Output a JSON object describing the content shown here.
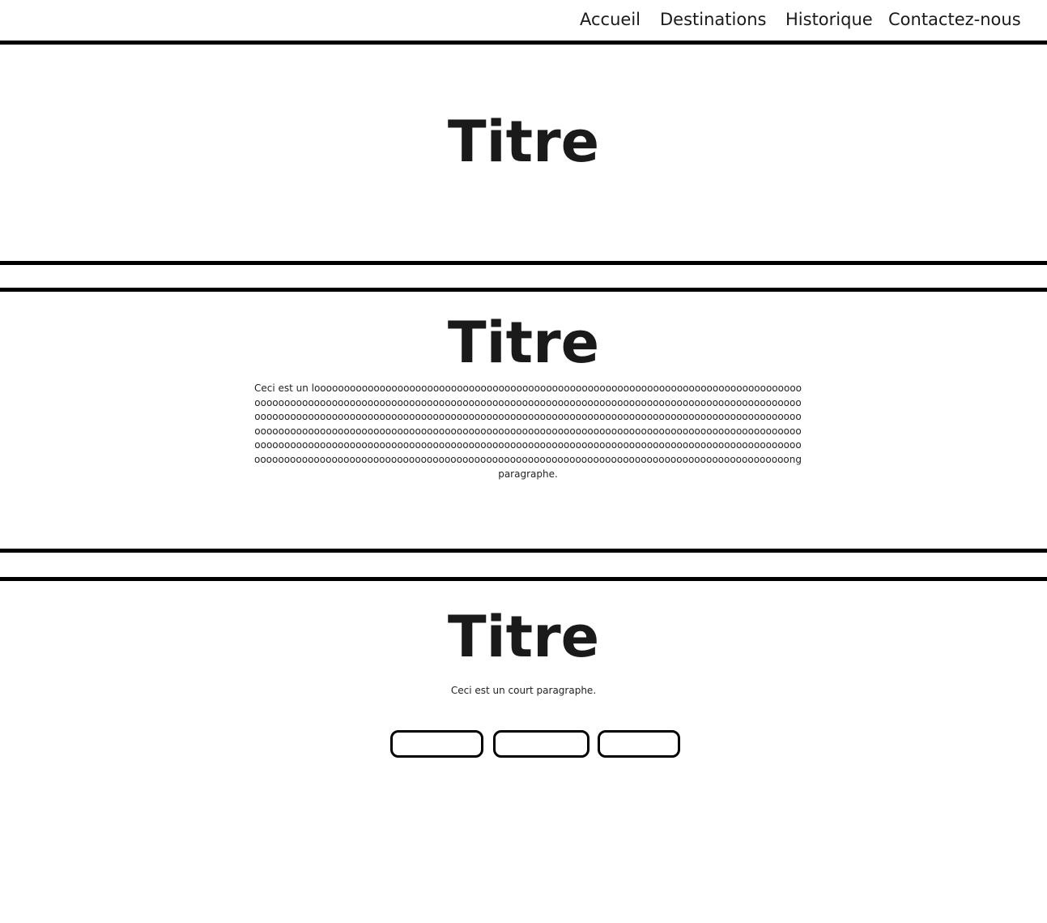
{
  "nav": {
    "items": [
      {
        "label": "Accueil"
      },
      {
        "label": "Destinations"
      },
      {
        "label": "Historique"
      },
      {
        "label": "Contactez-nous"
      }
    ]
  },
  "sections": [
    {
      "title": "Titre"
    },
    {
      "title": "Titre",
      "paragraph": "Ceci est un loooooooooooooooooooooooooooooooooooooooooooooooooooooooooooooooooooooooooooooooooooooooooooooooooooooooooooooooooooooooooooooooooooooooooooooooooooooooooooooooooooooooooooooooooooooooooooooooooooooooooooooooooooooooooooooooooooooooooooooooooooooooooooooooooooooooooooooooooooooooooooooooooooooooooooooooooooooooooooooooooooooooooooooooooooooooooooooooooooooooooooooooooooooooooooooooooooooooooooooooooooooooooooooooooooooooooooooooooooooooooooooooooooooooooooooooooooooooooooooooooooooooooooooooooooooooooooooooooooooooooooooooooooooooooooong paragraphe."
    },
    {
      "title": "Titre",
      "paragraph": "Ceci est un court paragraphe.",
      "buttons": [
        "",
        "",
        ""
      ]
    }
  ]
}
